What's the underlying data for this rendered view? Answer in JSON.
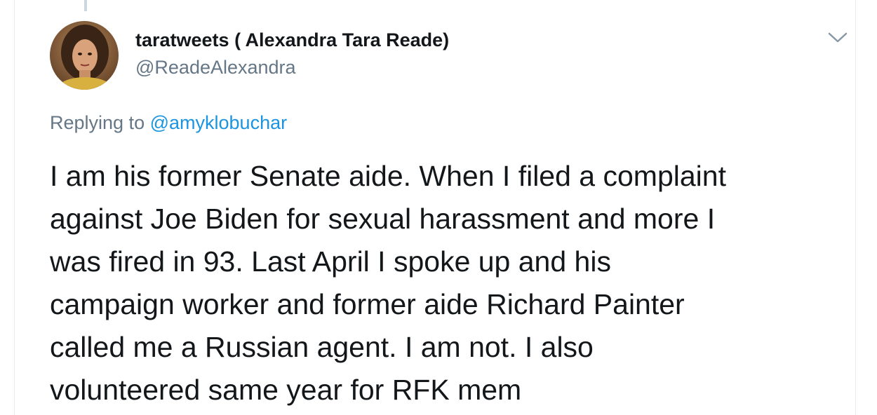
{
  "tweet": {
    "display_name": "taratweets ( Alexandra Tara Reade)",
    "handle": "@ReadeAlexandra",
    "replying_prefix": "Replying to",
    "replying_to": "@amyklobuchar",
    "text_lines": [
      "I am his former Senate aide. When I filed a complaint",
      "against Joe Biden for sexual harassment and more I",
      "was fired in 93. Last April I spoke up and his",
      "campaign worker and former aide Richard Painter",
      "called me a Russian agent. I am not. I also",
      "volunteered same year for RFK mem"
    ],
    "menu_icon": "chevron-down-icon",
    "avatar_icon": "profile-photo"
  },
  "colors": {
    "text": "#14171a",
    "secondary": "#657786",
    "link": "#1b95e0",
    "border": "#e6ecf0"
  }
}
